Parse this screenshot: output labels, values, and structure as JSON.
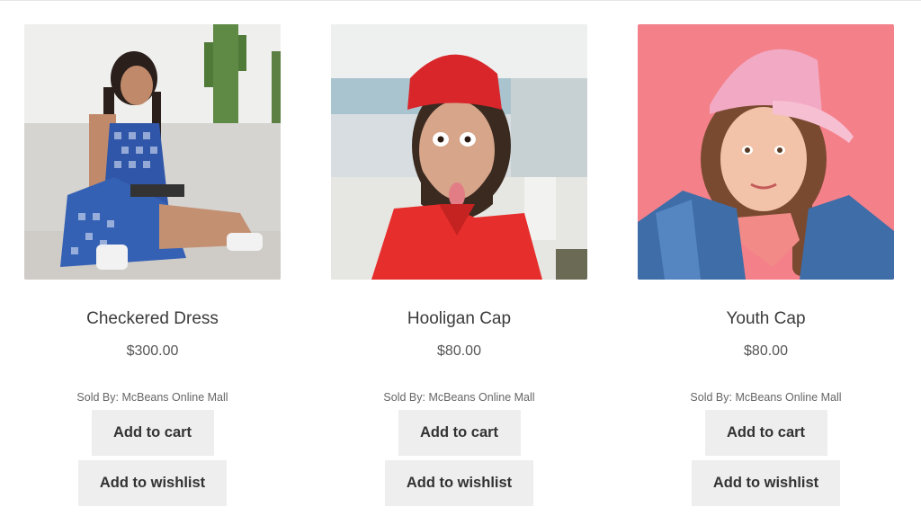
{
  "products": [
    {
      "image_alt": "checkered-dress-photo",
      "title": "Checkered Dress",
      "price": "$300.00",
      "sold_by": "Sold By: McBeans Online Mall",
      "cart_label": "Add to cart",
      "wishlist_label": "Add to wishlist"
    },
    {
      "image_alt": "hooligan-cap-photo",
      "title": "Hooligan Cap",
      "price": "$80.00",
      "sold_by": "Sold By: McBeans Online Mall",
      "cart_label": "Add to cart",
      "wishlist_label": "Add to wishlist"
    },
    {
      "image_alt": "youth-cap-photo",
      "title": "Youth Cap",
      "price": "$80.00",
      "sold_by": "Sold By: McBeans Online Mall",
      "cart_label": "Add to cart",
      "wishlist_label": "Add to wishlist"
    }
  ],
  "colors": {
    "button_bg": "#eeeeee",
    "text": "#333333",
    "image1_bg": "#dcdcdc",
    "image2_bg": "#c8d2d8",
    "image3_bg": "#f4808a"
  }
}
